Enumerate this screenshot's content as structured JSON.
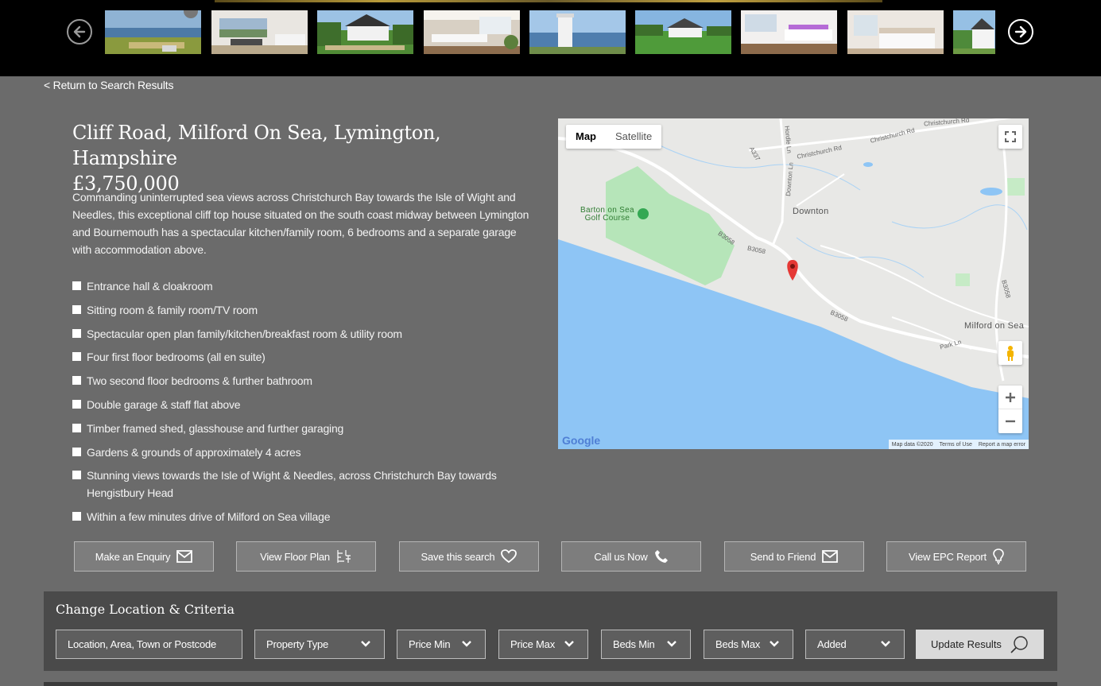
{
  "gallery": {
    "prev_icon": "arrow-left-circle-icon",
    "next_icon": "arrow-right-circle-icon",
    "thumbnails": [
      {
        "name": "thumb-sea-view"
      },
      {
        "name": "thumb-living-room"
      },
      {
        "name": "thumb-house-exterior"
      },
      {
        "name": "thumb-kitchen"
      },
      {
        "name": "thumb-chimney-sea"
      },
      {
        "name": "thumb-garden-house"
      },
      {
        "name": "thumb-kitchen-purple"
      },
      {
        "name": "thumb-bedroom"
      },
      {
        "name": "thumb-house-side"
      }
    ]
  },
  "nav": {
    "back_prefix": "< Return to ",
    "back_link": "Search Results"
  },
  "property": {
    "address": "Cliff Road, Milford On Sea, Lymington, Hampshire",
    "price": "£3,750,000",
    "description": "Commanding uninterrupted sea views across Christchurch Bay towards the Isle of Wight and Needles, this exceptional cliff top house situated on the south coast midway between Lymington and Bournemouth has a spectacular kitchen/family room, 6 bedrooms and a separate garage with accommodation above.",
    "features": [
      "Entrance hall & cloakroom",
      "Sitting room & family room/TV room",
      "Spectacular open plan family/kitchen/breakfast room & utility room",
      "Four first floor bedrooms (all en suite)",
      "Two second floor bedrooms & further bathroom",
      "Double garage & staff flat above",
      "Timber framed shed, glasshouse and further garaging",
      "Gardens & grounds of approximately 4 acres",
      "Stunning views towards the Isle of Wight & Needles, across Christchurch Bay towards Hengistbury Head",
      "Within a few minutes drive of Milford on Sea village"
    ]
  },
  "map": {
    "type_map": "Map",
    "type_satellite": "Satellite",
    "labels": {
      "downton": "Downton",
      "golf": "Barton on Sea\nGolf Course",
      "milford": "Milford on Sea",
      "christchurch_rd_1": "Christchurch Rd",
      "christchurch_rd_2": "Christchurch Rd",
      "christchurch_rd_3": "Christchurch Rd",
      "a337": "A337",
      "hordle_ln": "Hordle Ln",
      "downton_ln": "Downton Ln",
      "b3058_1": "B3058",
      "b3058_2": "B3058",
      "b3058_3": "B3058",
      "b3058_4": "B3058",
      "park_ln": "Park Ln"
    },
    "logo": "Google",
    "attribution": "Map data ©2020",
    "terms": "Terms of Use",
    "report": "Report a map error",
    "colors": {
      "sea": "#8ec5f5",
      "land": "#e8e8e6",
      "park": "#b6e5b9"
    }
  },
  "actions": [
    {
      "label": "Make an Enquiry",
      "icon": "envelope-icon"
    },
    {
      "label": "View Floor Plan",
      "icon": "floor-plan-icon"
    },
    {
      "label": "Save this search",
      "icon": "heart-icon"
    },
    {
      "label": "Call us Now",
      "icon": "phone-icon"
    },
    {
      "label": "Send to Friend",
      "icon": "envelope-icon"
    },
    {
      "label": "View EPC Report",
      "icon": "lightbulb-icon"
    }
  ],
  "criteria": {
    "heading": "Change Location & Criteria",
    "location_placeholder": "Location, Area, Town or Postcode",
    "property_type": "Property Type",
    "price_min": "Price Min",
    "price_max": "Price Max",
    "beds_min": "Beds Min",
    "beds_max": "Beds Max",
    "added": "Added",
    "update": "Update Results"
  }
}
